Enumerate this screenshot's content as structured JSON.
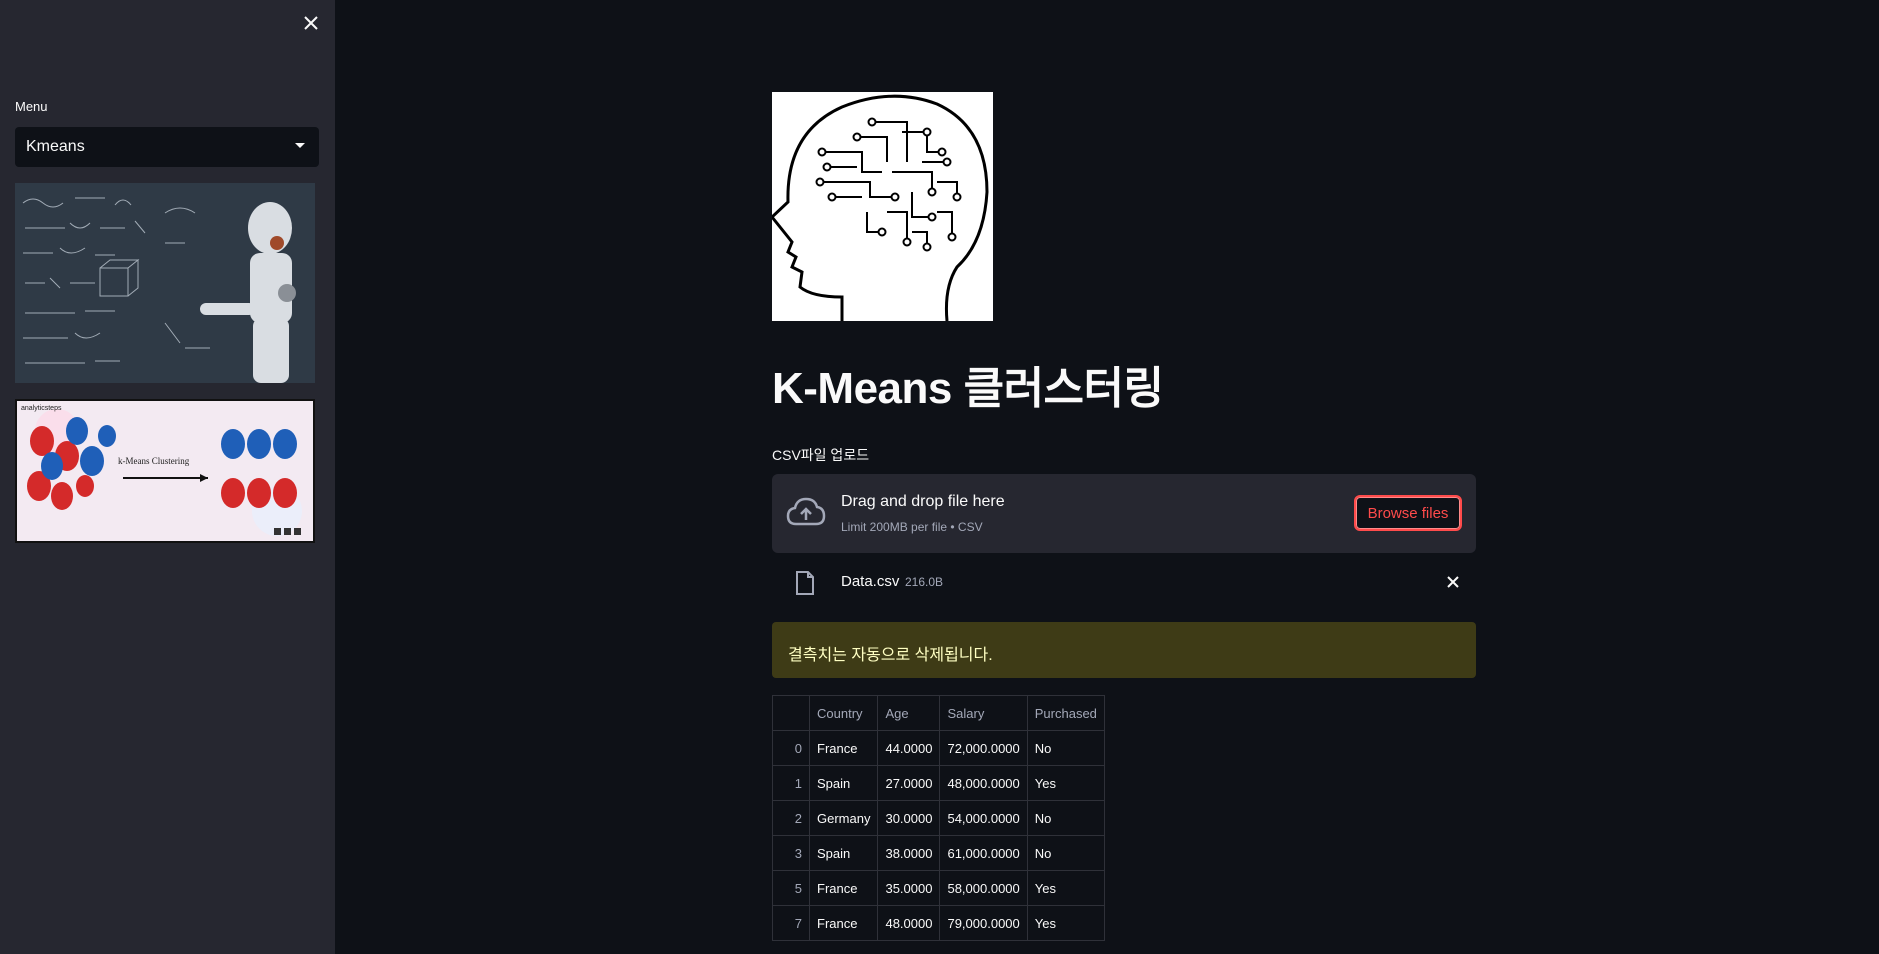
{
  "sidebar": {
    "menu_label": "Menu",
    "menu_selected": "Kmeans",
    "image2_logo_text": "analyticsteps",
    "image2_caption": "k-Means Clustering"
  },
  "main": {
    "title": "K-Means 클러스터링",
    "upload": {
      "label": "CSV파일 업로드",
      "dropzone_title": "Drag and drop file here",
      "dropzone_sub": "Limit 200MB per file • CSV",
      "browse_label": "Browse files"
    },
    "file": {
      "name": "Data.csv",
      "size": "216.0B"
    },
    "warning": "결측치는 자동으로 삭제됩니다.",
    "table": {
      "columns": [
        "",
        "Country",
        "Age",
        "Salary",
        "Purchased"
      ],
      "rows": [
        [
          "0",
          "France",
          "44.0000",
          "72,000.0000",
          "No"
        ],
        [
          "1",
          "Spain",
          "27.0000",
          "48,000.0000",
          "Yes"
        ],
        [
          "2",
          "Germany",
          "30.0000",
          "54,000.0000",
          "No"
        ],
        [
          "3",
          "Spain",
          "38.0000",
          "61,000.0000",
          "No"
        ],
        [
          "5",
          "France",
          "35.0000",
          "58,000.0000",
          "Yes"
        ],
        [
          "7",
          "France",
          "48.0000",
          "79,000.0000",
          "Yes"
        ]
      ]
    }
  },
  "colors": {
    "background": "#0e1117",
    "sidebar": "#262730",
    "accent": "#ff4b4b",
    "warning_bg": "#3e3b16",
    "warning_text": "#ffffc2"
  }
}
